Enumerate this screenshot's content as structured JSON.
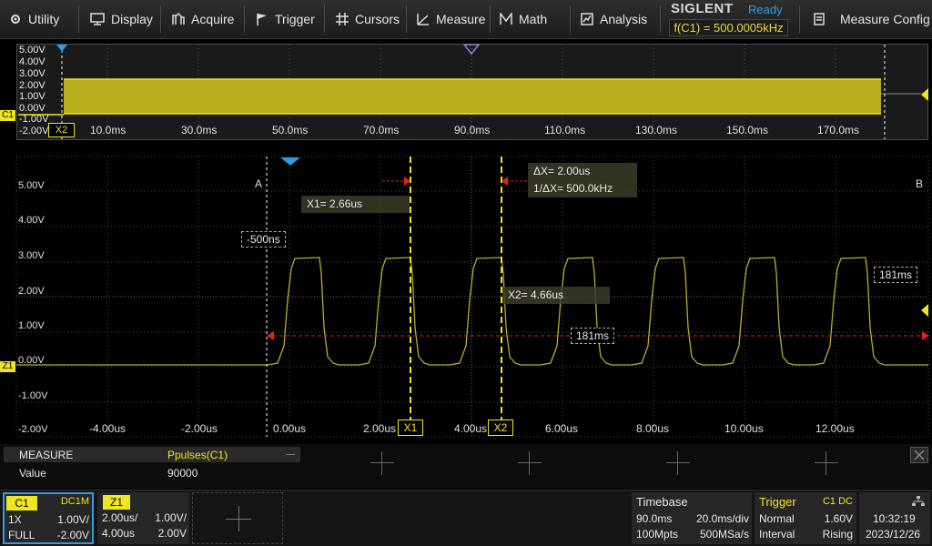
{
  "menu": {
    "utility": "Utility",
    "display": "Display",
    "acquire": "Acquire",
    "trigger": "Trigger",
    "cursors": "Cursors",
    "measure": "Measure",
    "math": "Math",
    "analysis": "Analysis",
    "brand": "SIGLENT",
    "status": "Ready",
    "freq": "f(C1) = 500.0005kHz",
    "measure_config": "Measure Config"
  },
  "overview": {
    "channel_tag": "C1",
    "y_labels": [
      "5.00V",
      "4.00V",
      "3.00V",
      "2.00V",
      "1.00V",
      "0.00V",
      "-1.00V",
      "-2.00V"
    ],
    "x_labels": [
      "10.0ms",
      "30.0ms",
      "50.0ms",
      "70.0ms",
      "90.0ms",
      "110.0ms",
      "130.0ms",
      "150.0ms",
      "170.0ms"
    ],
    "x2_tag": "X2"
  },
  "main": {
    "y_labels": [
      "5.00V",
      "4.00V",
      "3.00V",
      "2.00V",
      "1.00V",
      "0.00V",
      "-1.00V",
      "-2.00V"
    ],
    "x_labels": [
      "-4.00us",
      "-2.00us",
      "0.00us",
      "2.00us",
      "4.00us",
      "6.00us",
      "8.00us",
      "10.00us",
      "12.00us"
    ],
    "x1_tag": "X1",
    "x2_tag": "X2",
    "z1_tag": "Z1",
    "cursor_a": "A",
    "cursor_b": "B",
    "x1_readout": "X1= 2.66us",
    "x2_readout": "X2= 4.66us",
    "dx_readout": "ΔX= 2.00us",
    "inv_dx_readout": "1/ΔX= 500.0kHz",
    "offset_label": "-500ns",
    "span_right": "181ms",
    "span_center": "181ms"
  },
  "measure": {
    "header": "MEASURE",
    "param": "Ppulses(C1)",
    "row_label": "Value",
    "value": "90000"
  },
  "channels": {
    "c1": {
      "tag": "C1",
      "coupling": "DC1M",
      "probe": "1X",
      "scale": "1.00V/",
      "bw": "FULL",
      "offset": "-2.00V"
    },
    "z1": {
      "tag": "Z1",
      "scale": "2.00us/",
      "vscale": "1.00V/",
      "delay": "4.00us",
      "voffset": "2.00V"
    }
  },
  "timebase": {
    "title": "Timebase",
    "delay": "90.0ms",
    "scale": "20.0ms/div",
    "points": "100Mpts",
    "rate": "500MSa/s"
  },
  "trigger": {
    "title": "Trigger",
    "source": "C1 DC",
    "mode": "Normal",
    "level": "1.60V",
    "type": "Interval",
    "slope": "Rising"
  },
  "clock": {
    "time": "10:32:19",
    "date": "2023/12/26"
  },
  "colors": {
    "ch1": "#f0e620",
    "accent": "#2e9be6",
    "cursor_red": "#e02020"
  }
}
